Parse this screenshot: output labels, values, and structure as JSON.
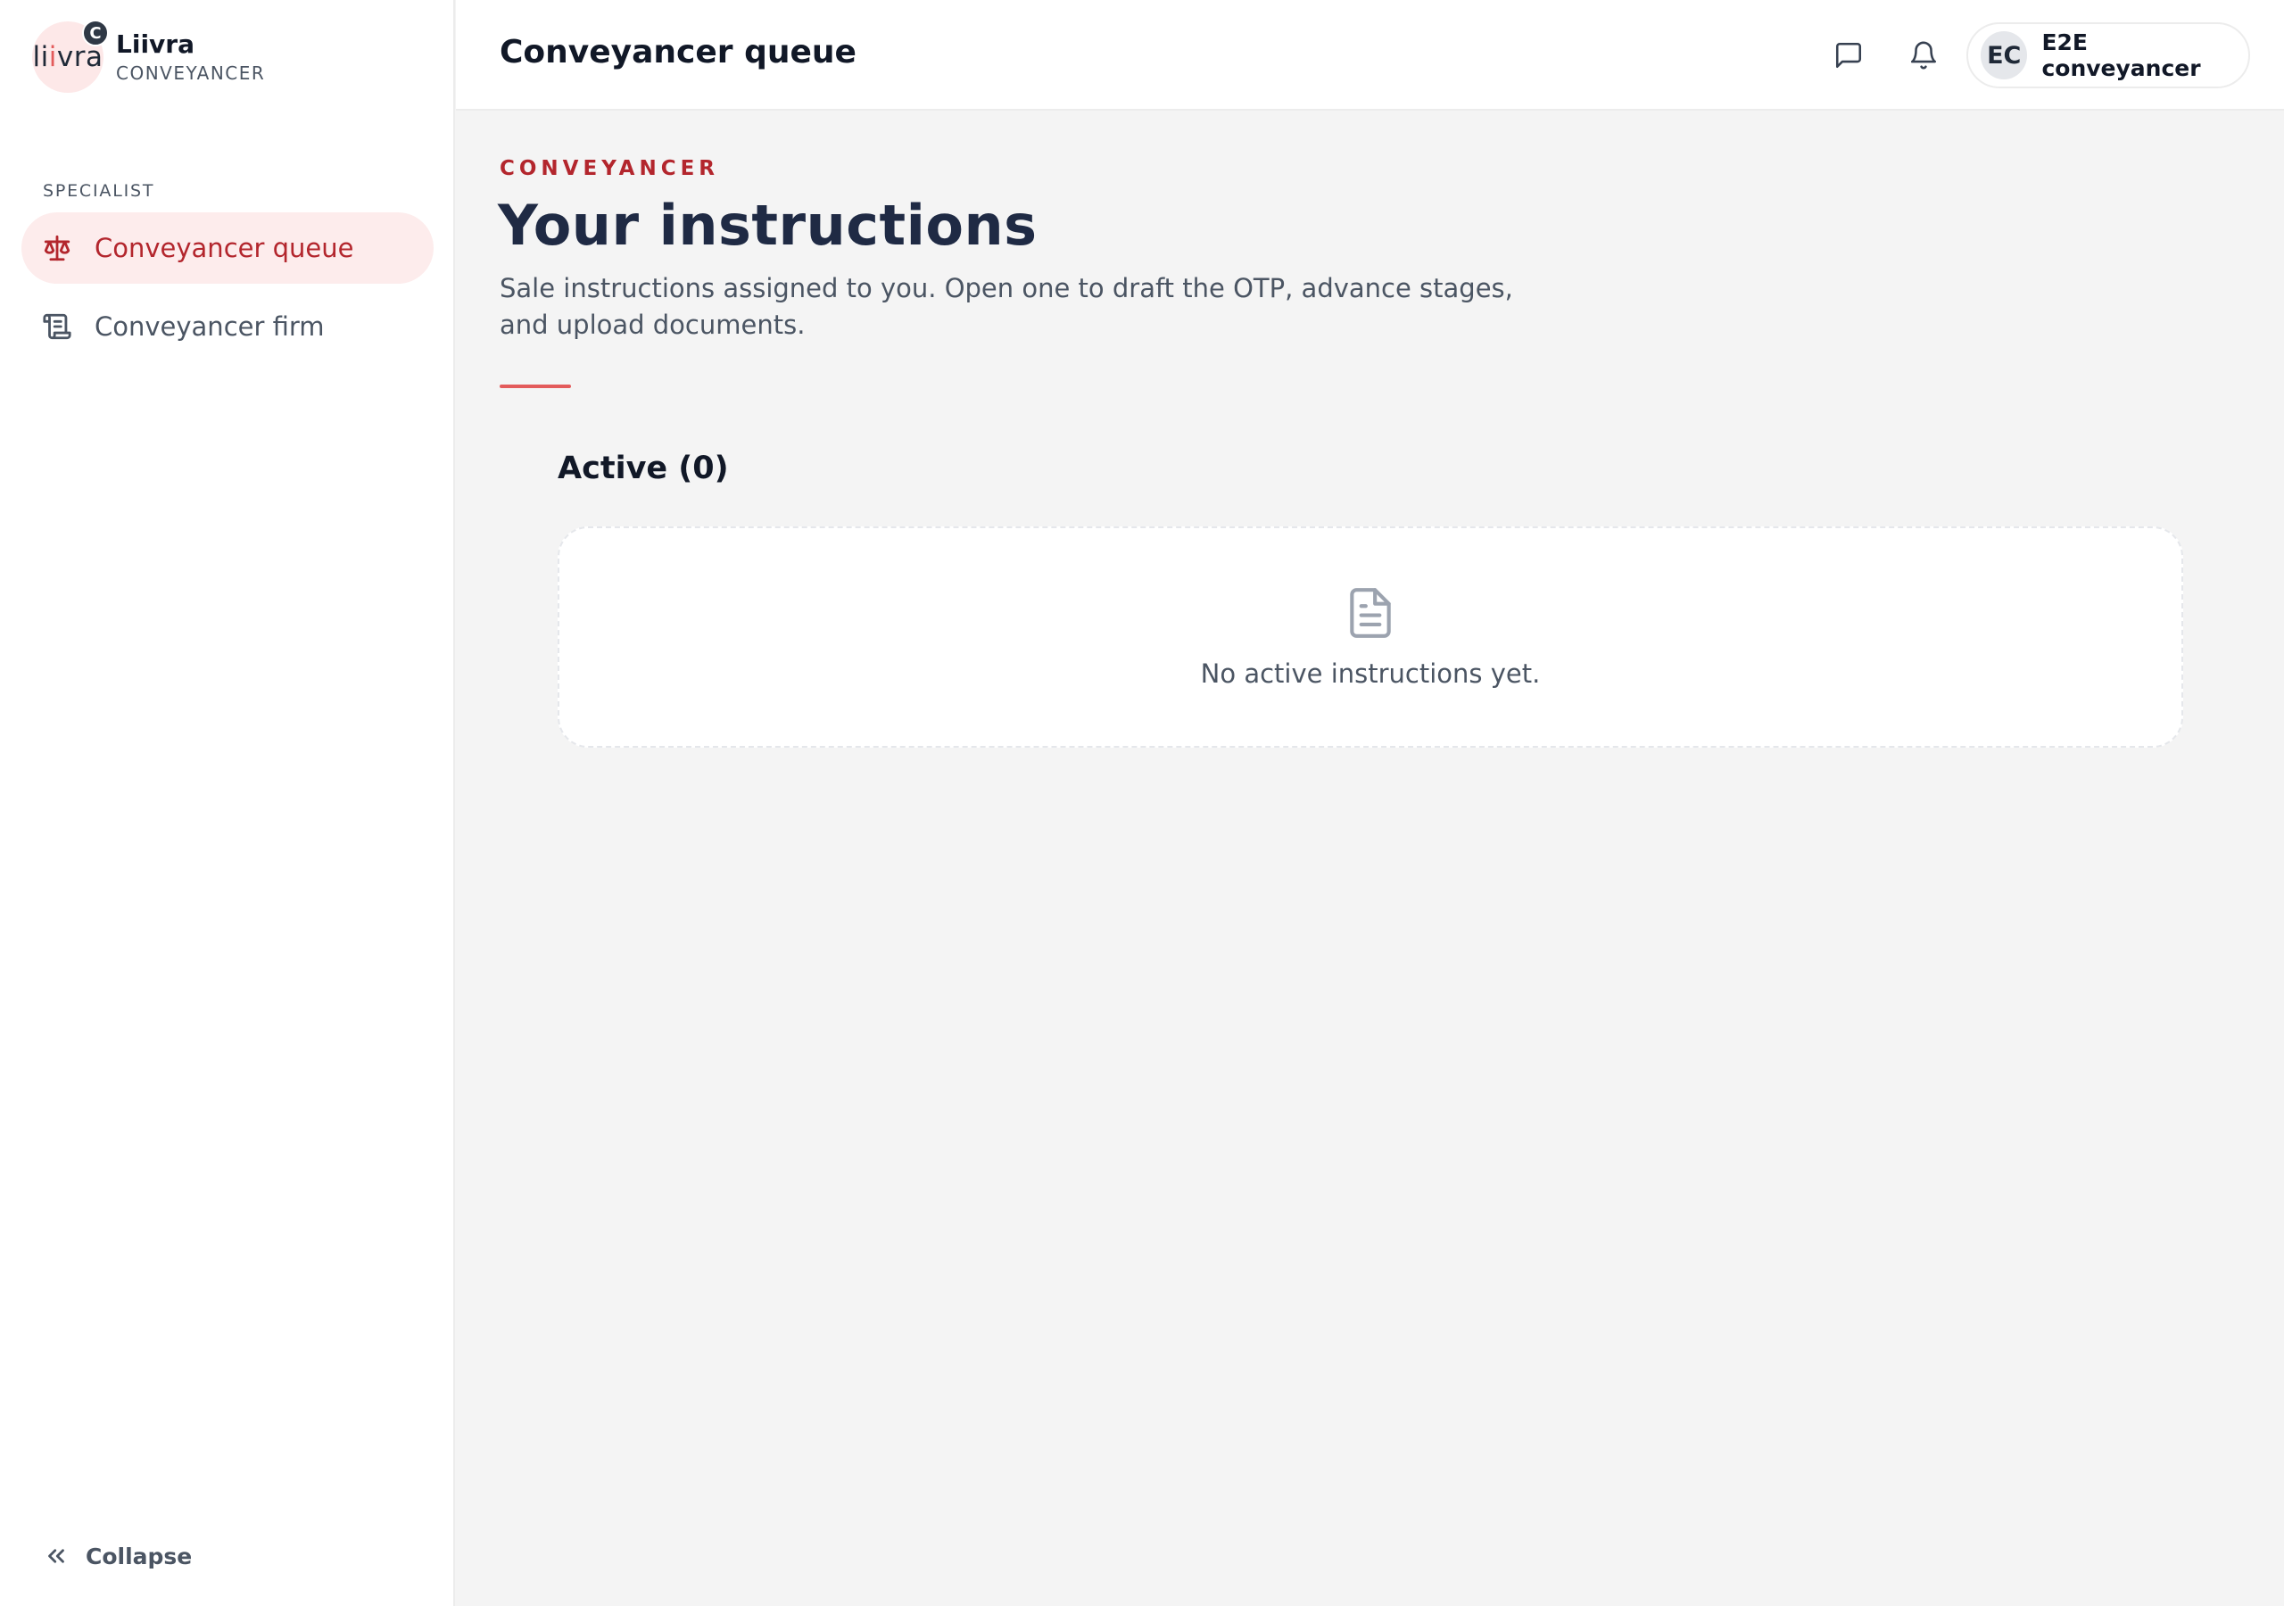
{
  "brand": {
    "logo_text_1": "li",
    "logo_text_accent": "i",
    "logo_text_2": "vra",
    "badge": "C",
    "name": "Liivra",
    "role": "CONVEYANCER"
  },
  "sidebar": {
    "section_label": "SPECIALIST",
    "items": [
      {
        "label": "Conveyancer queue",
        "icon": "scale-icon",
        "active": true
      },
      {
        "label": "Conveyancer firm",
        "icon": "document-scroll-icon",
        "active": false
      }
    ],
    "collapse_label": "Collapse"
  },
  "header": {
    "title": "Conveyancer queue",
    "user": {
      "initials": "EC",
      "name": "E2E conveyancer"
    }
  },
  "main": {
    "eyebrow": "CONVEYANCER",
    "title": "Your instructions",
    "subtitle": "Sale instructions assigned to you. Open one to draft the OTP, advance stages, and upload documents.",
    "active_section": {
      "title": "Active (0)",
      "empty_message": "No active instructions yet."
    }
  },
  "colors": {
    "accent": "#b3262d",
    "accent_light": "#fdecec",
    "rule": "#e35b5b",
    "background": "#f4f4f4"
  }
}
